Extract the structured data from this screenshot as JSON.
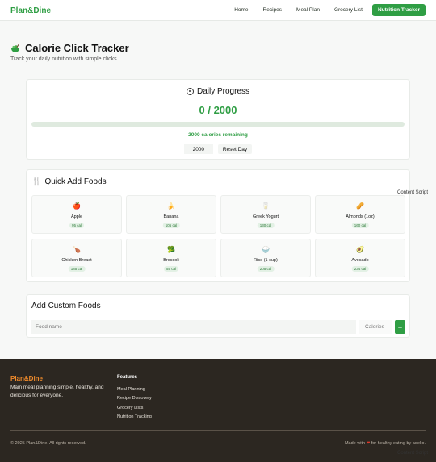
{
  "nav": {
    "brand": "Plan&Dine",
    "links": [
      "Home",
      "Recipes",
      "Meal Plan",
      "Grocery List"
    ],
    "cta": "Nutrition Tracker"
  },
  "header": {
    "title": "Calorie Click Tracker",
    "subtitle": "Track your daily nutrition with simple clicks",
    "icon": "salad-bowl-icon"
  },
  "progress": {
    "title": "Daily Progress",
    "count": "0 / 2000",
    "consumed": 0,
    "goal": 2000,
    "remaining": "2000 calories remaining",
    "goal_value": "2000",
    "reset_label": "Reset Day"
  },
  "quick_add": {
    "title": "Quick Add Foods",
    "foods": [
      {
        "name": "Apple",
        "cal": "95 cal",
        "icon": "🍎"
      },
      {
        "name": "Banana",
        "cal": "105 cal",
        "icon": "🍌"
      },
      {
        "name": "Greek Yogurt",
        "cal": "130 cal",
        "icon": "🥛"
      },
      {
        "name": "Almonds (1oz)",
        "cal": "160 cal",
        "icon": "🥜"
      },
      {
        "name": "Chicken Breast",
        "cal": "185 cal",
        "icon": "🍗"
      },
      {
        "name": "Broccoli",
        "cal": "55 cal",
        "icon": "🥦"
      },
      {
        "name": "Rice (1 cup)",
        "cal": "205 cal",
        "icon": "🍚"
      },
      {
        "name": "Avocado",
        "cal": "234 cal",
        "icon": "🥑"
      }
    ]
  },
  "custom": {
    "title": "Add Custom Foods",
    "food_placeholder": "Food name",
    "cal_placeholder": "Calories",
    "add_label": "+"
  },
  "overlay": {
    "content_script": "Content Script"
  },
  "footer": {
    "brand": "Plan&Dine",
    "tagline": "Main meal planning simple, healthy, and delicious for everyone.",
    "features_title": "Features",
    "features": [
      "Meal Planning",
      "Recipe Discovery",
      "Grocery Lists",
      "Nutrition Tracking"
    ],
    "copyright": "© 2025 Plan&Dine. All rights reserved.",
    "made_prefix": "Made with",
    "made_suffix": "for healthy eating by adello."
  },
  "colors": {
    "accent": "#2f9e44",
    "footer_bg": "#2c2721",
    "footer_brand": "#ee8a2b"
  }
}
